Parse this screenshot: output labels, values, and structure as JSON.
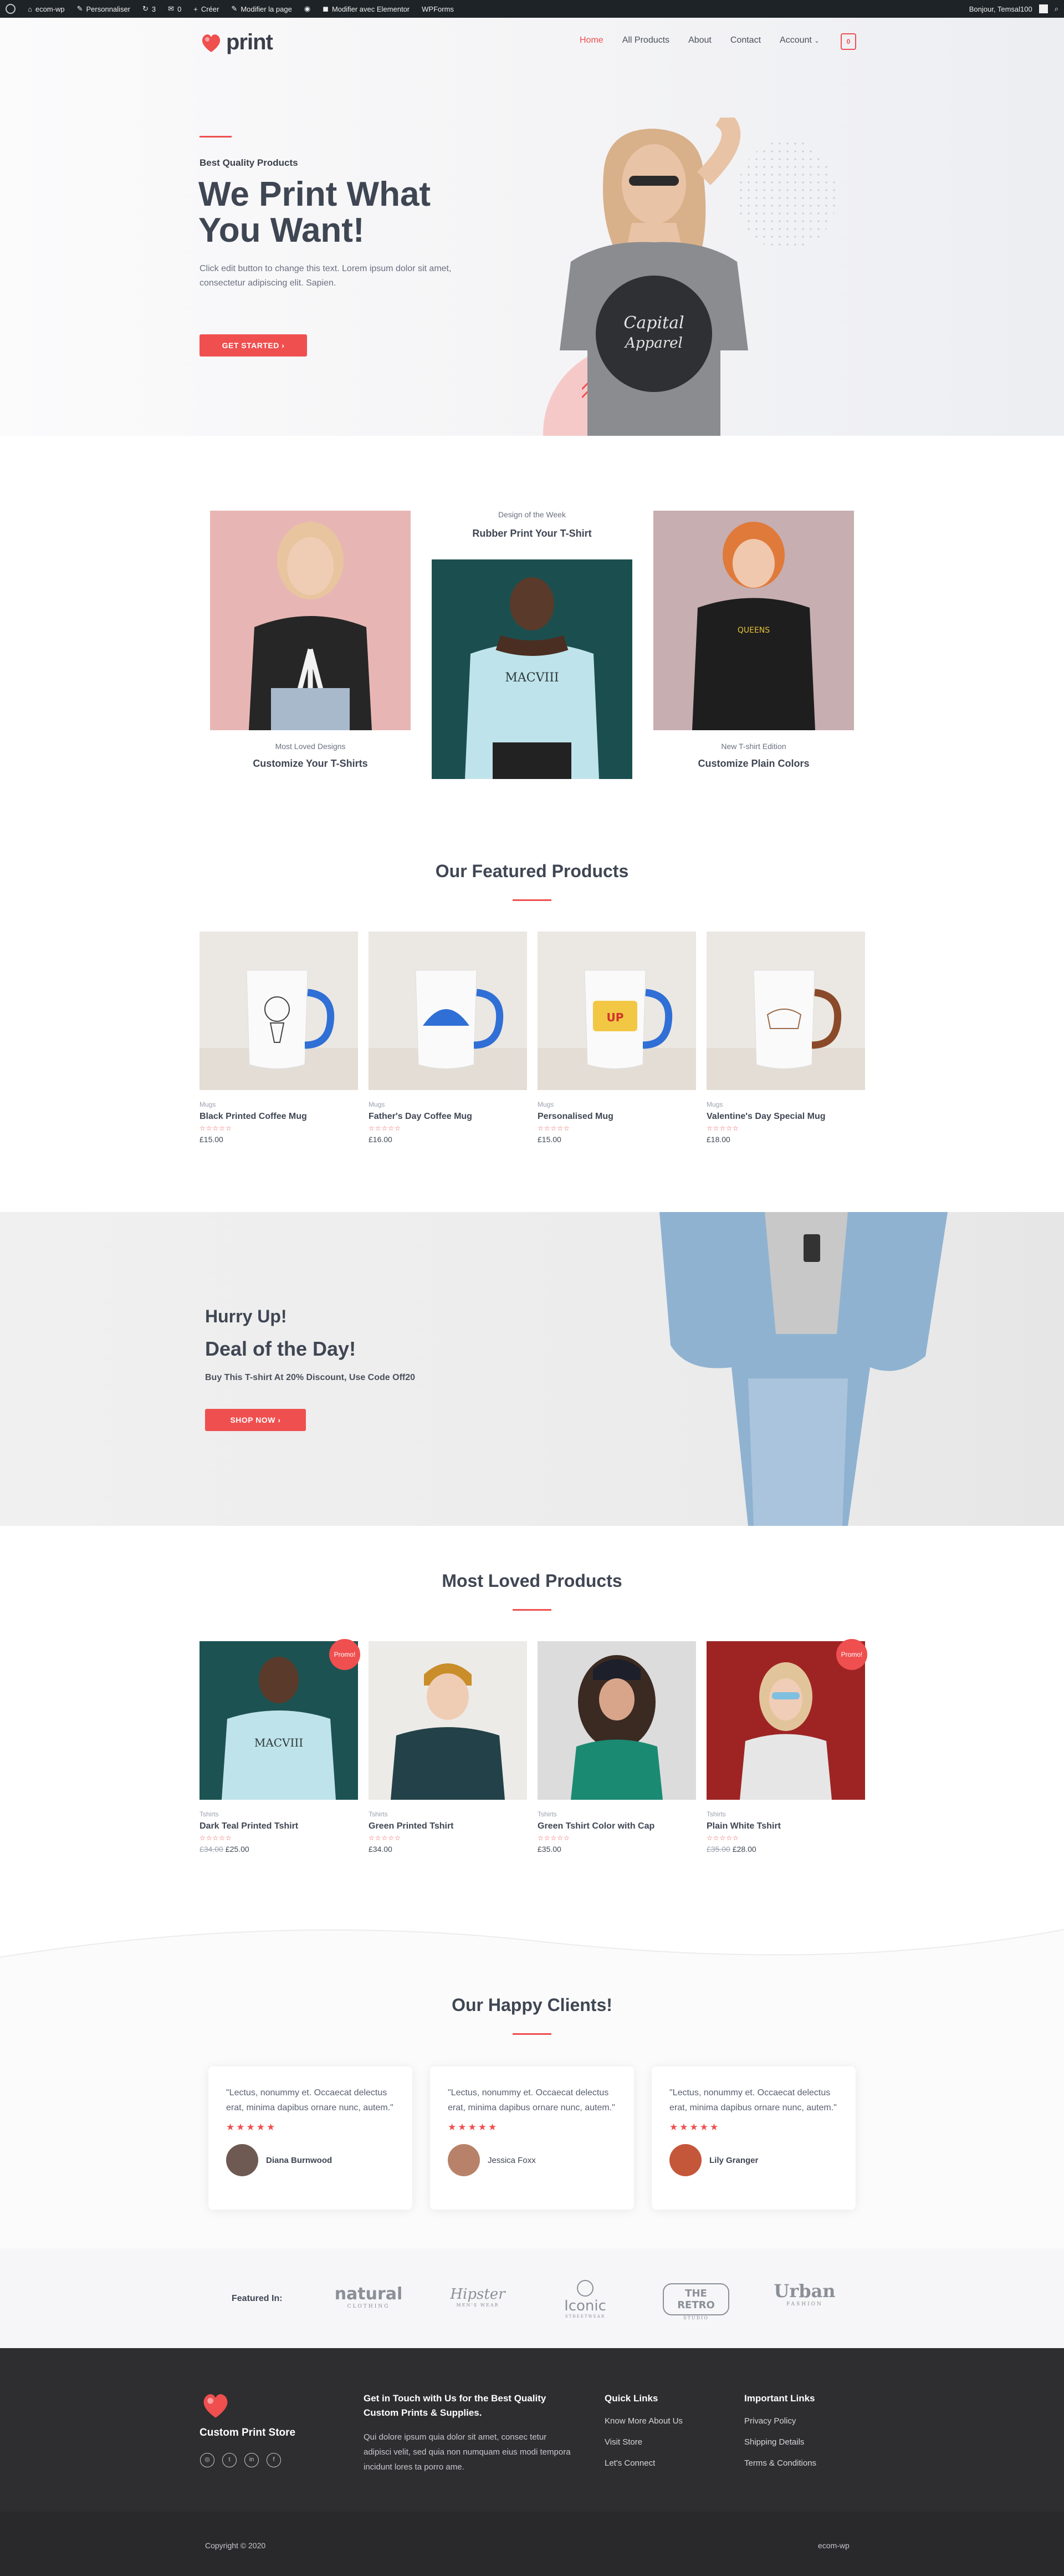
{
  "admin_bar": {
    "site": "ecom-wp",
    "customize": "Personnaliser",
    "updates": "3",
    "comments": "0",
    "new": "Créer",
    "edit": "Modifier la page",
    "elementor": "Modifier avec Elementor",
    "wpforms": "WPForms",
    "greeting": "Bonjour, Temsal100"
  },
  "header": {
    "logo_text": "print",
    "nav": [
      "Home",
      "All Products",
      "About",
      "Contact",
      "Account"
    ],
    "cart_count": "0"
  },
  "hero": {
    "eyebrow": "Best Quality Products",
    "title": "We Print What You Want!",
    "text": "Click edit button to change this text. Lorem ipsum dolor sit amet, consectetur adipiscing elit. Sapien.",
    "button": "GET STARTED"
  },
  "designs": [
    {
      "caption": "Most Loved Designs",
      "title": "Customize Your T-Shirts"
    },
    {
      "caption": "Design of the Week",
      "title": "Rubber Print Your T-Shirt"
    },
    {
      "caption": "New T-shirt Edition",
      "title": "Customize Plain Colors"
    }
  ],
  "featured": {
    "title": "Our Featured Products",
    "products": [
      {
        "category": "Mugs",
        "name": "Black Printed Coffee Mug",
        "price": "£15.00",
        "stars": "☆☆☆☆☆"
      },
      {
        "category": "Mugs",
        "name": "Father's Day Coffee Mug",
        "price": "£16.00",
        "stars": "☆☆☆☆☆"
      },
      {
        "category": "Mugs",
        "name": "Personalised Mug",
        "price": "£15.00",
        "stars": "☆☆☆☆☆"
      },
      {
        "category": "Mugs",
        "name": "Valentine's Day Special Mug",
        "price": "£18.00",
        "stars": "☆☆☆☆☆"
      }
    ]
  },
  "deal": {
    "kicker": "Hurry Up!",
    "title": "Deal of the Day!",
    "text": "Buy This T-shirt At 20% Discount, Use Code Off20",
    "button": "SHOP NOW"
  },
  "loved": {
    "title": "Most Loved Products",
    "promo": "Promo!",
    "products": [
      {
        "category": "Tshirts",
        "name": "Dark Teal Printed Tshirt",
        "old_price": "£34.00",
        "price": "£25.00",
        "stars": "☆☆☆☆☆"
      },
      {
        "category": "Tshirts",
        "name": "Green Printed Tshirt",
        "old_price": "",
        "price": "£34.00",
        "stars": "☆☆☆☆☆"
      },
      {
        "category": "Tshirts",
        "name": "Green Tshirt Color with Cap",
        "old_price": "",
        "price": "£35.00",
        "stars": "☆☆☆☆☆"
      },
      {
        "category": "Tshirts",
        "name": "Plain White Tshirt",
        "old_price": "£35.00",
        "price": "£28.00",
        "stars": "☆☆☆☆☆"
      }
    ]
  },
  "clients": {
    "title": "Our Happy Clients!",
    "testimonials": [
      {
        "quote": "\"Lectus, nonummy et. Occaecat delectus erat, minima dapibus ornare nunc, autem.\"",
        "stars": "★★★★★",
        "name": "Diana Burnwood"
      },
      {
        "quote": "\"Lectus, nonummy et. Occaecat delectus erat, minima dapibus ornare nunc, autem.\"",
        "stars": "★★★★★",
        "name": "Jessica Foxx"
      },
      {
        "quote": "\"Lectus, nonummy et. Occaecat delectus erat, minima dapibus ornare nunc, autem.\"",
        "stars": "★★★★★",
        "name": "Lily Granger"
      }
    ]
  },
  "featured_in": {
    "label": "Featured In:",
    "brands": [
      {
        "name": "natural",
        "sub": "CLOTHING"
      },
      {
        "name": "Hipster",
        "sub": "MEN'S WEAR"
      },
      {
        "name": "Iconic",
        "sub": "STREETWEAR"
      },
      {
        "name": "THE RETRO",
        "sub": "STUDIO"
      },
      {
        "name": "Urban",
        "sub": "FASHION"
      }
    ]
  },
  "footer": {
    "brand": "Custom Print Store",
    "contact_title": "Get in Touch with Us for the Best Quality Custom Prints & Supplies.",
    "contact_text": "Qui dolore ipsum quia dolor sit amet, consec tetur adipisci velit, sed quia non numquam eius modi tempora incidunt lores ta porro ame.",
    "quick_title": "Quick Links",
    "quick_links": [
      "Know More About Us",
      "Visit Store",
      "Let's Connect"
    ],
    "important_title": "Important Links",
    "important_links": [
      "Privacy Policy",
      "Shipping Details",
      "Terms & Conditions"
    ],
    "social": [
      "instagram-icon",
      "twitter-icon",
      "linkedin-icon",
      "facebook-icon"
    ],
    "copyright": "Copyright © 2020",
    "site": "ecom-wp"
  },
  "colors": {
    "accent": "#ef4f4f",
    "dark": "#3f4653",
    "footer": "#2e2e30"
  }
}
